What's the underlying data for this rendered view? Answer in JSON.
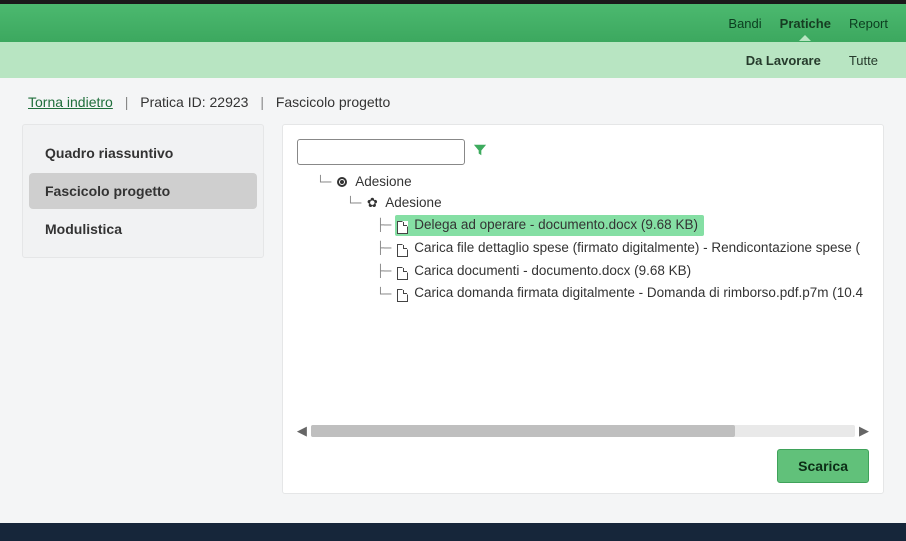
{
  "topnav": {
    "items": [
      "Bandi",
      "Pratiche",
      "Report"
    ],
    "activeIndex": 1
  },
  "subnav": {
    "items": [
      "Da Lavorare",
      "Tutte"
    ],
    "boldIndex": 0
  },
  "breadcrumb": {
    "back": "Torna indietro",
    "practiceLabel": "Pratica ID: 22923",
    "section": "Fascicolo progetto"
  },
  "sidebar": {
    "items": [
      {
        "label": "Quadro riassuntivo"
      },
      {
        "label": "Fascicolo progetto"
      },
      {
        "label": "Modulistica"
      }
    ],
    "activeIndex": 1
  },
  "filter": {
    "value": "",
    "placeholder": ""
  },
  "tree": {
    "root": {
      "label": "Adesione"
    },
    "group": {
      "label": "Adesione"
    },
    "files": [
      {
        "label": "Delega ad operare - documento.docx (9.68 KB)",
        "selected": true
      },
      {
        "label": "Carica file dettaglio spese (firmato digitalmente) - Rendicontazione spese (",
        "selected": false
      },
      {
        "label": "Carica documenti - documento.docx (9.68 KB)",
        "selected": false
      },
      {
        "label": "Carica domanda firmata digitalmente - Domanda di rimborso.pdf.p7m (10.4",
        "selected": false
      }
    ]
  },
  "actions": {
    "download": "Scarica"
  }
}
